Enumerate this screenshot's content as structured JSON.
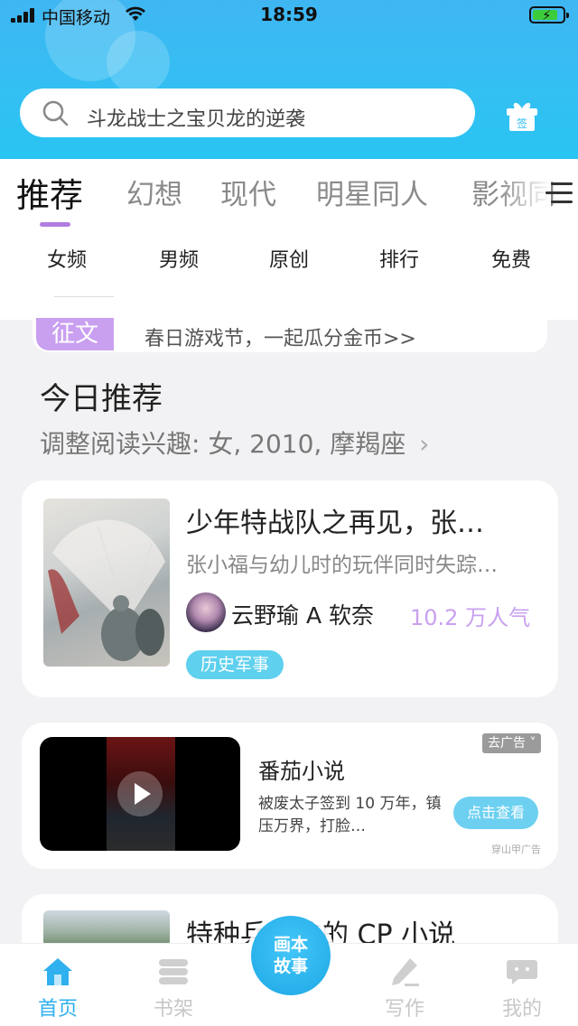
{
  "status_bar": {
    "carrier": "中国移动",
    "time": "18:59",
    "battery_level": 0.85
  },
  "search": {
    "placeholder": "斗龙战士之宝贝龙的逆袭",
    "icon": "search-icon",
    "gift_icon": "gift-icon",
    "gift_label": "签"
  },
  "category_tabs": [
    {
      "label": "推荐",
      "active": true
    },
    {
      "label": "幻想",
      "active": false
    },
    {
      "label": "现代",
      "active": false
    },
    {
      "label": "明星同人",
      "active": false
    },
    {
      "label": "影视同",
      "active": false
    }
  ],
  "sub_tabs": [
    "女频",
    "男频",
    "原创",
    "排行",
    "免费"
  ],
  "notice": {
    "tag": "征文",
    "text": "春日游戏节，一起瓜分金币>>"
  },
  "section": {
    "title": "今日推荐",
    "subtitle": "调整阅读兴趣: 女, 2010, 摩羯座",
    "chevron": "›"
  },
  "book_card": {
    "title": "少年特战队之再见，张…",
    "description": "张小福与幼儿时的玩伴同时失踪…",
    "author": "云野瑜 A 软奈",
    "popularity": "10.2 万人气",
    "genre": "历史军事"
  },
  "ad_card": {
    "title": "番茄小说",
    "description": "被废太子签到 10 万年，镇压万界，打脸…",
    "button": "点击查看",
    "close_label": "去广告 ˅",
    "source": "穿山甲广告"
  },
  "book_card_2": {
    "title": "特种兵学校的 CP 小说"
  },
  "bottom_nav": {
    "items": [
      {
        "label": "首页",
        "icon": "home-icon",
        "active": true
      },
      {
        "label": "书架",
        "icon": "bookshelf-icon",
        "active": false
      },
      {
        "label": "写作",
        "icon": "pen-icon",
        "active": false
      },
      {
        "label": "我的",
        "icon": "chat-bubble-icon",
        "active": false
      }
    ],
    "center_button": "画本故事"
  },
  "colors": {
    "header": "#33c0f3",
    "accent_purple": "#c9a0f0",
    "tag_blue": "#5fd0ee",
    "nav_active": "#2fb0ef"
  }
}
